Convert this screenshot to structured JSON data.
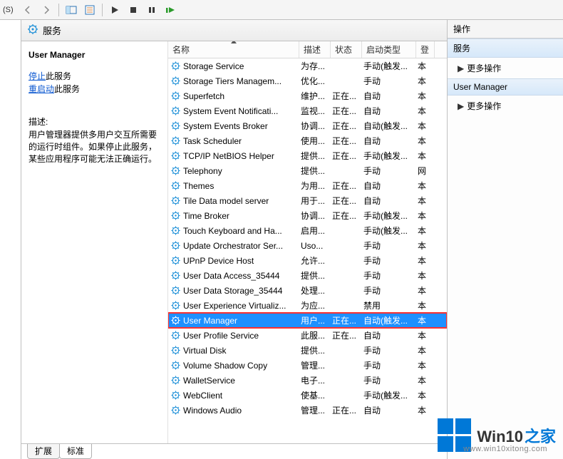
{
  "toolbar_title_fragment": "(S)",
  "services_header": "服务",
  "detail": {
    "title": "User Manager",
    "stop_link": "停止",
    "stop_suffix": "此服务",
    "restart_link": "重启动",
    "restart_suffix": "此服务",
    "desc_label": "描述:",
    "desc_text": "用户管理器提供多用户交互所需要的运行时组件。如果停止此服务，某些应用程序可能无法正确运行。"
  },
  "columns": {
    "name": "名称",
    "desc": "描述",
    "status": "状态",
    "startup": "启动类型",
    "logon": "登"
  },
  "rows": [
    {
      "name": "Storage Service",
      "desc": "为存...",
      "status": "",
      "startup": "手动(触发...",
      "logon": "本"
    },
    {
      "name": "Storage Tiers Managem...",
      "desc": "优化...",
      "status": "",
      "startup": "手动",
      "logon": "本"
    },
    {
      "name": "Superfetch",
      "desc": "维护...",
      "status": "正在...",
      "startup": "自动",
      "logon": "本"
    },
    {
      "name": "System Event Notificati...",
      "desc": "监视...",
      "status": "正在...",
      "startup": "自动",
      "logon": "本"
    },
    {
      "name": "System Events Broker",
      "desc": "协调...",
      "status": "正在...",
      "startup": "自动(触发...",
      "logon": "本"
    },
    {
      "name": "Task Scheduler",
      "desc": "使用...",
      "status": "正在...",
      "startup": "自动",
      "logon": "本"
    },
    {
      "name": "TCP/IP NetBIOS Helper",
      "desc": "提供...",
      "status": "正在...",
      "startup": "手动(触发...",
      "logon": "本"
    },
    {
      "name": "Telephony",
      "desc": "提供...",
      "status": "",
      "startup": "手动",
      "logon": "网"
    },
    {
      "name": "Themes",
      "desc": "为用...",
      "status": "正在...",
      "startup": "自动",
      "logon": "本"
    },
    {
      "name": "Tile Data model server",
      "desc": "用于...",
      "status": "正在...",
      "startup": "自动",
      "logon": "本"
    },
    {
      "name": "Time Broker",
      "desc": "协调...",
      "status": "正在...",
      "startup": "手动(触发...",
      "logon": "本"
    },
    {
      "name": "Touch Keyboard and Ha...",
      "desc": "启用...",
      "status": "",
      "startup": "手动(触发...",
      "logon": "本"
    },
    {
      "name": "Update Orchestrator Ser...",
      "desc": "Uso...",
      "status": "",
      "startup": "手动",
      "logon": "本"
    },
    {
      "name": "UPnP Device Host",
      "desc": "允许...",
      "status": "",
      "startup": "手动",
      "logon": "本"
    },
    {
      "name": "User Data Access_35444",
      "desc": "提供...",
      "status": "",
      "startup": "手动",
      "logon": "本"
    },
    {
      "name": "User Data Storage_35444",
      "desc": "处理...",
      "status": "",
      "startup": "手动",
      "logon": "本"
    },
    {
      "name": "User Experience Virtualiz...",
      "desc": "为应...",
      "status": "",
      "startup": "禁用",
      "logon": "本"
    },
    {
      "name": "User Manager",
      "desc": "用户...",
      "status": "正在...",
      "startup": "自动(触发...",
      "logon": "本",
      "selected": true,
      "highlighted": true
    },
    {
      "name": "User Profile Service",
      "desc": "此服...",
      "status": "正在...",
      "startup": "自动",
      "logon": "本"
    },
    {
      "name": "Virtual Disk",
      "desc": "提供...",
      "status": "",
      "startup": "手动",
      "logon": "本"
    },
    {
      "name": "Volume Shadow Copy",
      "desc": "管理...",
      "status": "",
      "startup": "手动",
      "logon": "本"
    },
    {
      "name": "WalletService",
      "desc": "电子...",
      "status": "",
      "startup": "手动",
      "logon": "本"
    },
    {
      "name": "WebClient",
      "desc": "使基...",
      "status": "",
      "startup": "手动(触发...",
      "logon": "本"
    },
    {
      "name": "Windows Audio",
      "desc": "管理...",
      "status": "正在...",
      "startup": "自动",
      "logon": "本"
    }
  ],
  "tabs": {
    "extended": "扩展",
    "standard": "标准"
  },
  "right": {
    "header": "操作",
    "section1": "服务",
    "more1": "更多操作",
    "section2": "User Manager",
    "more2": "更多操作"
  },
  "logo": {
    "brand": "Win10",
    "suffix": "之家",
    "url": "www.win10xitong.com"
  }
}
